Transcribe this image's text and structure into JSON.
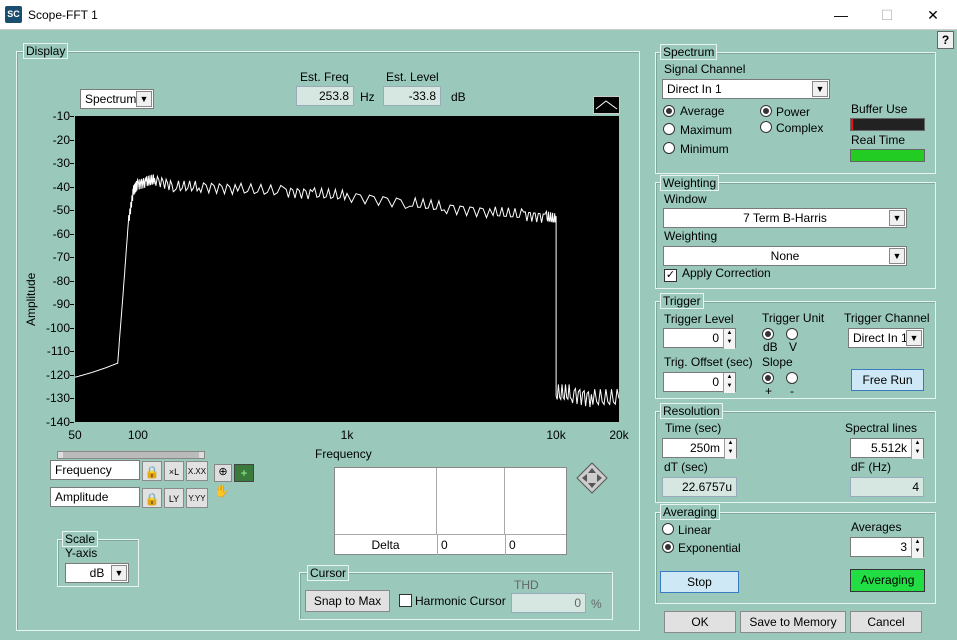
{
  "window": {
    "title": "Scope-FFT 1",
    "icon": "SC",
    "help": "?"
  },
  "display": {
    "group": "Display",
    "view_select": "Spectrum",
    "est_freq_label": "Est. Freq",
    "est_freq": "253.8",
    "est_freq_unit": "Hz",
    "est_level_label": "Est. Level",
    "est_level": "-33.8",
    "est_level_unit": "dB",
    "ylabel": "Amplitude",
    "xlabel": "Frequency",
    "x_ticks": [
      "50",
      "100",
      "1k",
      "10k",
      "20k"
    ],
    "y_ticks": [
      "-10",
      "-20",
      "-30",
      "-40",
      "-50",
      "-60",
      "-70",
      "-80",
      "-90",
      "-100",
      "-110",
      "-120",
      "-130",
      "-140"
    ],
    "freq_axis": "Frequency",
    "amp_axis": "Amplitude",
    "x_scale_btn": "X.XX",
    "y_scale_btn": "Y.YY"
  },
  "chart_data": {
    "type": "line",
    "x_scale": "log",
    "xlim": [
      50,
      20000
    ],
    "ylim": [
      -140,
      -10
    ],
    "x": [
      50,
      60,
      70,
      80,
      85,
      90,
      95,
      100,
      110,
      120,
      150,
      200,
      300,
      500,
      700,
      1000,
      2000,
      3000,
      5000,
      7000,
      9000,
      10000,
      10000,
      12000,
      15000,
      20000
    ],
    "y": [
      -121,
      -119,
      -117,
      -115,
      -85,
      -55,
      -42,
      -39,
      -38,
      -37,
      -40,
      -40,
      -41,
      -42,
      -43,
      -44,
      -47,
      -49,
      -51,
      -52,
      -53,
      -54,
      -128,
      -128,
      -130,
      -130
    ],
    "grid": false,
    "background": "#000000",
    "line_color": "#ffffff"
  },
  "cursor_table": {
    "delta_label": "Delta",
    "col1": "0",
    "col2": "0"
  },
  "scale": {
    "group": "Scale",
    "yaxis_label": "Y-axis",
    "yaxis_value": "dB"
  },
  "cursor": {
    "group": "Cursor",
    "snap": "Snap to Max",
    "harmonic": "Harmonic Cursor",
    "thd_label": "THD",
    "thd_value": "0",
    "thd_unit": "%"
  },
  "spectrum": {
    "group": "Spectrum",
    "signal_channel_label": "Signal Channel",
    "signal_channel": "Direct In 1",
    "average": "Average",
    "maximum": "Maximum",
    "minimum": "Minimum",
    "power": "Power",
    "complex": "Complex",
    "buffer_use": "Buffer Use",
    "real_time": "Real Time",
    "buffer_use_level": 0.03,
    "real_time_level": 1.0
  },
  "weighting": {
    "group": "Weighting",
    "window_label": "Window",
    "window": "7 Term B-Harris",
    "weighting_label": "Weighting",
    "weighting": "None",
    "apply_correction": "Apply Correction"
  },
  "trigger": {
    "group": "Trigger",
    "level_label": "Trigger Level",
    "level": "0",
    "unit_label": "Trigger Unit",
    "db": "dB",
    "v": "V",
    "channel_label": "Trigger Channel",
    "channel": "Direct In 1",
    "offset_label": "Trig. Offset (sec)",
    "offset": "0",
    "slope_label": "Slope",
    "plus": "+",
    "minus": "-",
    "free_run": "Free Run"
  },
  "resolution": {
    "group": "Resolution",
    "time_label": "Time (sec)",
    "time": "250m",
    "dt_label": "dT (sec)",
    "dt": "22.6757u",
    "lines_label": "Spectral lines",
    "lines": "5.512k",
    "df_label": "dF (Hz)",
    "df": "4"
  },
  "averaging": {
    "group": "Averaging",
    "linear": "Linear",
    "exponential": "Exponential",
    "averages_label": "Averages",
    "averages": "3",
    "stop": "Stop",
    "averaging_btn": "Averaging"
  },
  "footer": {
    "ok": "OK",
    "save": "Save to Memory",
    "cancel": "Cancel"
  }
}
